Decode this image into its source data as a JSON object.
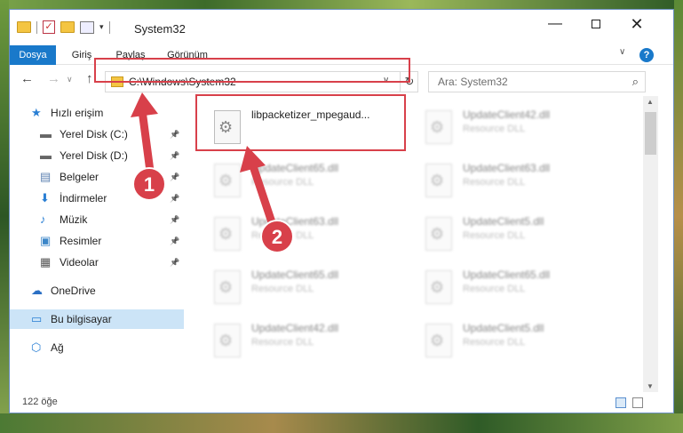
{
  "window": {
    "title": "System32",
    "minimize_glyph": "—",
    "close_glyph": "✕"
  },
  "ribbon": {
    "tabs": [
      "Dosya",
      "Giriş",
      "Paylaş",
      "Görünüm"
    ],
    "help_glyph": "?",
    "chevron_glyph": "∨"
  },
  "nav": {
    "back_glyph": "←",
    "forward_glyph": "→",
    "recent_glyph": "∨",
    "up_glyph": "↑",
    "address": "C:\\Windows\\System32",
    "address_chevron": "∨",
    "refresh_glyph": "↻",
    "search_placeholder": "Ara: System32",
    "search_glyph": "⌕"
  },
  "sidebar": {
    "items": [
      {
        "label": "Hızlı erişim",
        "icon": "star-icon",
        "pinned": false
      },
      {
        "label": "Yerel Disk (C:)",
        "icon": "drive-icon",
        "pinned": true
      },
      {
        "label": "Yerel Disk (D:)",
        "icon": "drive-icon",
        "pinned": true
      },
      {
        "label": "Belgeler",
        "icon": "documents-icon",
        "pinned": true
      },
      {
        "label": "İndirmeler",
        "icon": "download-icon",
        "pinned": true
      },
      {
        "label": "Müzik",
        "icon": "music-icon",
        "pinned": true
      },
      {
        "label": "Resimler",
        "icon": "pictures-icon",
        "pinned": true
      },
      {
        "label": "Videolar",
        "icon": "videos-icon",
        "pinned": true
      },
      {
        "label": "OneDrive",
        "icon": "cloud-icon",
        "pinned": false
      },
      {
        "label": "Bu bilgisayar",
        "icon": "computer-icon",
        "pinned": false,
        "selected": true
      },
      {
        "label": "Ağ",
        "icon": "network-icon",
        "pinned": false
      }
    ],
    "pin_glyph": "📌"
  },
  "files": [
    {
      "name": "libpacketizer_mpegaud...",
      "type": "",
      "highlighted": true
    },
    {
      "name": "UpdateClient42.dll",
      "type": "Resource DLL"
    },
    {
      "name": "UpdateClient65.dll",
      "type": "Resource DLL"
    },
    {
      "name": "UpdateClient63.dll",
      "type": "Resource DLL"
    },
    {
      "name": "UpdateClient63.dll",
      "type": "Resource DLL"
    },
    {
      "name": "UpdateClient5.dll",
      "type": "Resource DLL"
    },
    {
      "name": "UpdateClient65.dll",
      "type": "Resource DLL"
    },
    {
      "name": "UpdateClient65.dll",
      "type": "Resource DLL"
    },
    {
      "name": "UpdateClient42.dll",
      "type": "Resource DLL"
    },
    {
      "name": "UpdateClient5.dll",
      "type": "Resource DLL"
    }
  ],
  "status": {
    "item_count": "122 öğe"
  },
  "annotations": {
    "step1": "1",
    "step2": "2",
    "color": "#d8404a"
  }
}
